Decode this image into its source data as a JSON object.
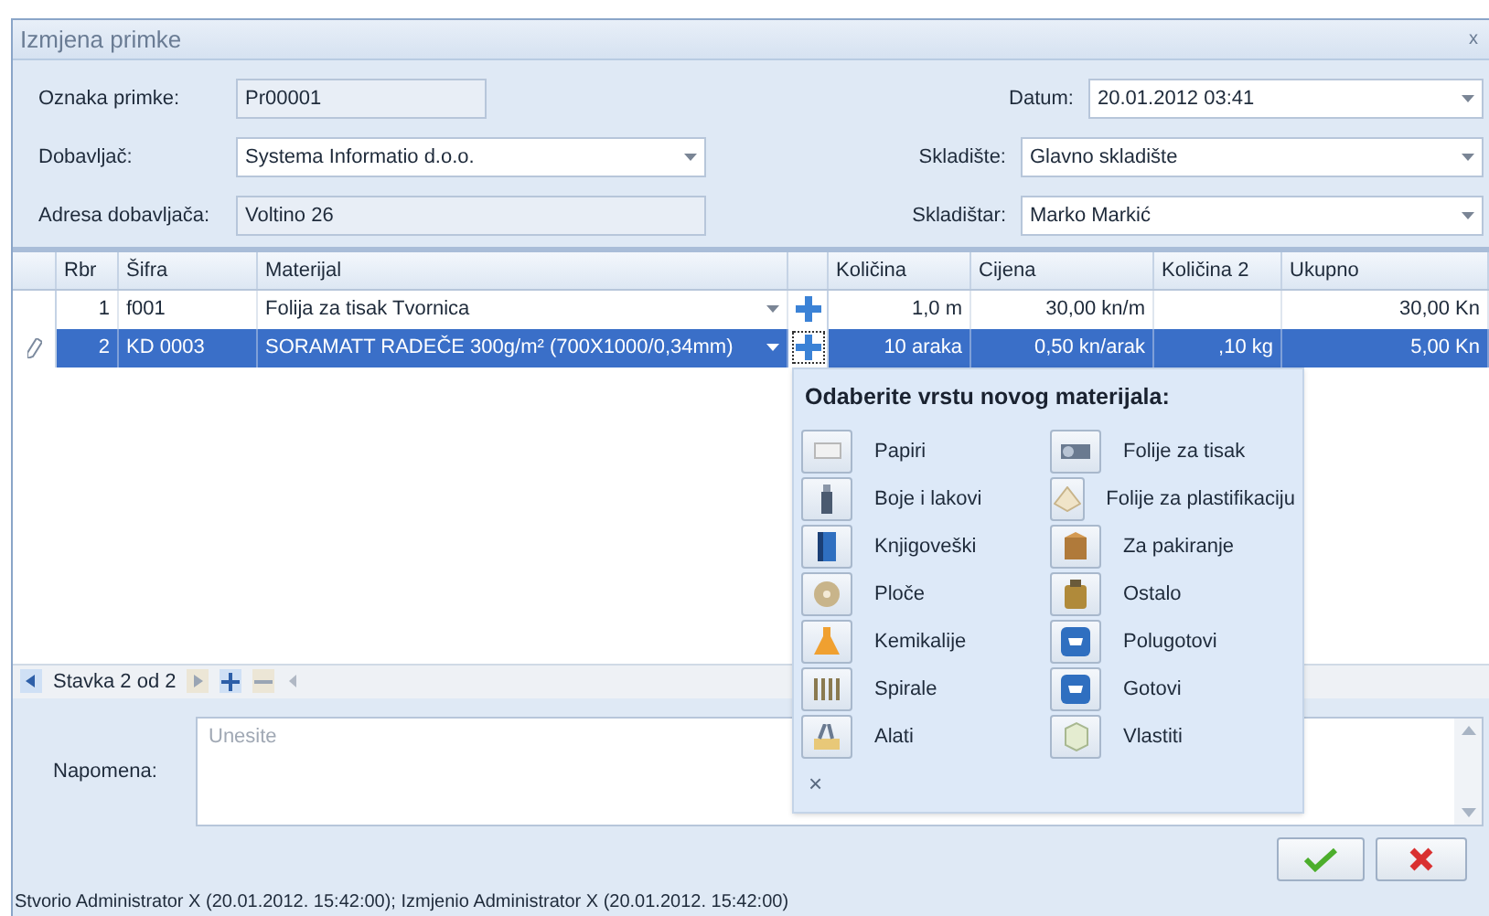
{
  "window": {
    "title": "Izmjena primke",
    "close": "x"
  },
  "form": {
    "left": [
      {
        "label": "Oznaka primke:",
        "value": "Pr00001",
        "kind": "text"
      },
      {
        "label": "Dobavljač:",
        "value": "Systema Informatio d.o.o.",
        "kind": "dropdown"
      },
      {
        "label": "Adresa dobavljača:",
        "value": "Voltino 26",
        "kind": "text"
      }
    ],
    "right": [
      {
        "label": "Datum:",
        "value": "20.01.2012 03:41",
        "kind": "dropdown"
      },
      {
        "label": "Skladište:",
        "value": "Glavno skladište",
        "kind": "dropdown"
      },
      {
        "label": "Skladištar:",
        "value": "Marko Markić",
        "kind": "dropdown"
      }
    ]
  },
  "grid": {
    "columns": [
      "Rbr",
      "Šifra",
      "Materijal",
      "Količina",
      "Cijena",
      "Količina 2",
      "Ukupno"
    ],
    "rows": [
      {
        "rbr": "1",
        "sifra": "f001",
        "materijal": "Folija za tisak Tvornica",
        "kolicina": "1,0 m",
        "cijena": "30,00 kn/m",
        "kolicina_2": "",
        "ukupno": "30,00 Kn",
        "selected": false
      },
      {
        "rbr": "2",
        "sifra": "KD 0003",
        "materijal": "SORAMATT RADEČE 300g/m² (700X1000/0,34mm)",
        "kolicina": "10 araka",
        "cijena": "0,50 kn/arak",
        "kolicina_2": ",10 kg",
        "ukupno": "5,00 Kn",
        "selected": true
      }
    ],
    "navigator": "Stavka 2 od 2"
  },
  "popup": {
    "title": "Odaberite vrstu novog materijala:",
    "close": "×",
    "items": [
      {
        "label": "Papiri"
      },
      {
        "label": "Boje i lakovi"
      },
      {
        "label": "Knjigoveški"
      },
      {
        "label": "Ploče"
      },
      {
        "label": "Kemikalije"
      },
      {
        "label": "Spirale"
      },
      {
        "label": "Alati"
      },
      {
        "label": "Folije za tisak"
      },
      {
        "label": "Folije za plastifikaciju"
      },
      {
        "label": "Za pakiranje"
      },
      {
        "label": "Ostalo"
      },
      {
        "label": "Polugotovi"
      },
      {
        "label": "Gotovi"
      },
      {
        "label": "Vlastiti"
      }
    ]
  },
  "note": {
    "label": "Napomena:",
    "placeholder": "Unesite"
  },
  "status": "Stvorio Administrator X (20.01.2012. 15:42:00); Izmjenio Administrator X (20.01.2012. 15:42:00)"
}
